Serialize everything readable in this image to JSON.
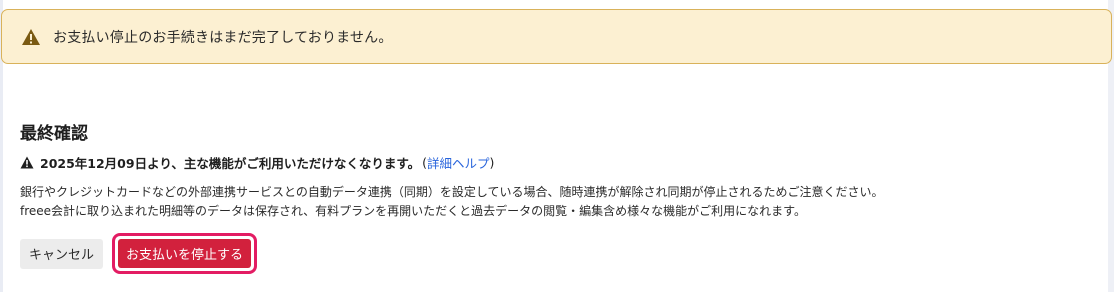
{
  "alert": {
    "icon": "warning-icon",
    "message": "お支払い停止のお手続きはまだ完了しておりません。",
    "background": "#fcf0d2",
    "border": "#d9b25a"
  },
  "confirmation": {
    "title": "最終確認",
    "warning": {
      "icon": "warning-icon",
      "text": "2025年12月09日より、主な機能がご利用いただけなくなります。",
      "paren_open": "(",
      "link_label": "詳細ヘルプ",
      "paren_close": ")"
    },
    "body_lines": [
      "銀行やクレジットカードなどの外部連携サービスとの自動データ連携（同期）を設定している場合、随時連携が解除され同期が停止されるためご注意ください。",
      "freee会計に取り込まれた明細等のデータは保存され、有料プランを再開いただくと過去データの閲覧・編集含め様々な機能がご利用になれます。"
    ]
  },
  "buttons": {
    "cancel_label": "キャンセル",
    "confirm_label": "お支払いを停止する",
    "confirm_color": "#d2213d",
    "highlight_color": "#e31c63"
  }
}
